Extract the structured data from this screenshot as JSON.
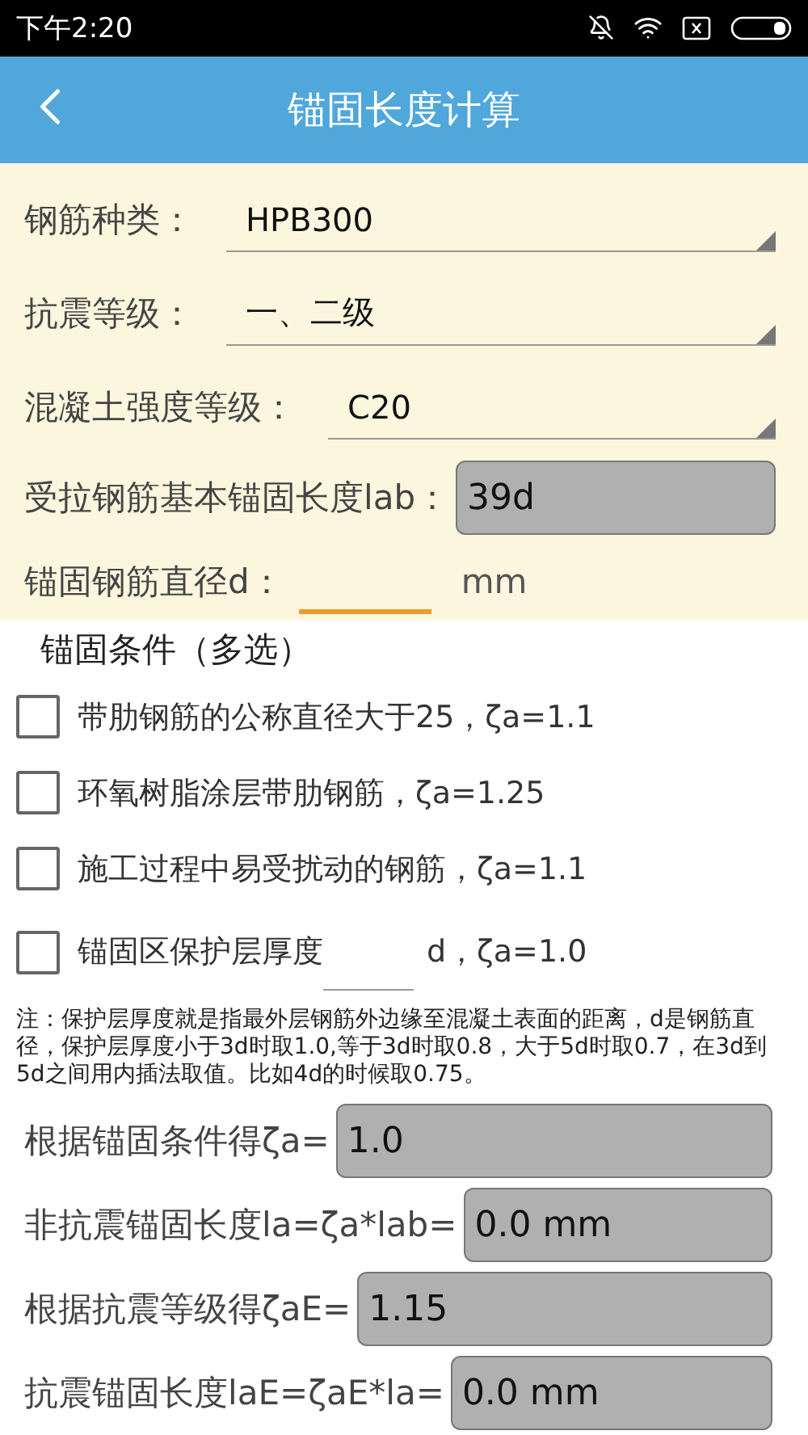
{
  "status_bar": {
    "time": "下午2:20"
  },
  "app_bar": {
    "title": "锚固长度计算"
  },
  "selects": [
    {
      "label": "钢筋种类：",
      "value": "HPB300"
    },
    {
      "label": "抗震等级：",
      "value": "一、二级"
    },
    {
      "label": "混凝土强度等级：",
      "value": "C20"
    }
  ],
  "base_length": {
    "label": "受拉钢筋基本锚固长度lab：",
    "value": "39d"
  },
  "diameter": {
    "label": "锚固钢筋直径d：",
    "unit": "mm"
  },
  "conditions": {
    "title": "锚固条件（多选）",
    "items": [
      {
        "kind": "plain",
        "label": "带肋钢筋的公称直径大于25，ζa=1.1",
        "checked": false
      },
      {
        "kind": "plain",
        "label": "环氧树脂涂层带肋钢筋，ζa=1.25",
        "checked": false
      },
      {
        "kind": "plain",
        "label": "施工过程中易受扰动的钢筋，ζa=1.1",
        "checked": false
      },
      {
        "kind": "with_input",
        "label": "锚固区保护层厚度",
        "suffix": "d，ζa=1.0",
        "checked": false
      }
    ]
  },
  "note": "注：保护层厚度就是指最外层钢筋外边缘至混凝土表面的距离，d是钢筋直径，保护层厚度小于3d时取1.0,等于3d时取0.8，大于5d时取0.7，在3d到5d之间用内插法取值。比如4d的时候取0.75。",
  "results": [
    {
      "label": "根据锚固条件得ζa=",
      "value": "1.0"
    },
    {
      "label": "非抗震锚固长度la=ζa*lab=",
      "value": "0.0 mm"
    },
    {
      "label": "根据抗震等级得ζaE=",
      "value": "1.15"
    },
    {
      "label": "抗震锚固长度laE=ζaE*la=",
      "value": "0.0 mm"
    }
  ]
}
